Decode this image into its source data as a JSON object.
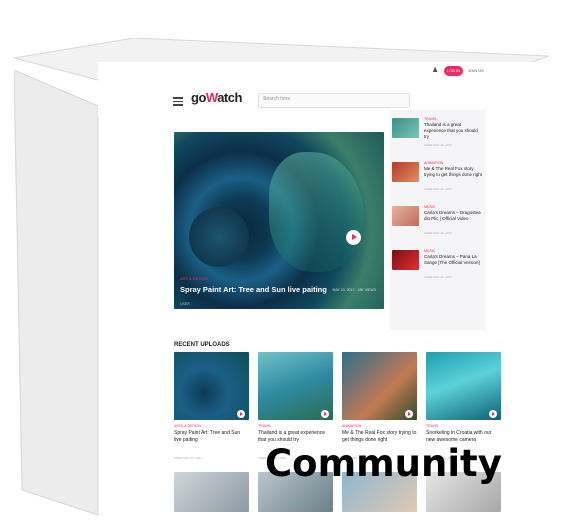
{
  "header": {
    "logo_text_pre": "go",
    "logo_text_accent": "W",
    "logo_text_post": "atch",
    "search_placeholder": "Search here",
    "signin_label": "LOG IN",
    "join_label": "JOIN US"
  },
  "hero": {
    "category": "ART & DESIGN",
    "title": "Spray Paint Art: Tree and Sun live paiting",
    "date": "MAY 24, 2017",
    "views": "18K VIEWS",
    "author": "USER"
  },
  "sidebar": {
    "items": [
      {
        "category": "TRAVEL",
        "title": "Thailand is a great experience that you should try",
        "meta": "USER   MAY 24, 2017"
      },
      {
        "category": "ANIMATION",
        "title": "Me & The Real Fox story trying to get things done right",
        "meta": "USER   MAY 24, 2017"
      },
      {
        "category": "MUSIC",
        "title": "Carla's Dreams – Dragostea din Plic | Official Video",
        "meta": "USER   MAY 24, 2017"
      },
      {
        "category": "MUSIC",
        "title": "Carla's Dreams – Pana La Sange [The Official Version]",
        "meta": "USER   MAY 24, 2017"
      }
    ]
  },
  "recent": {
    "heading": "RECENT UPLOADS",
    "cards": [
      {
        "category": "ARTS & DESIGN",
        "title": "Spray Paint Art: Tree and Sun live paiting",
        "meta": "USER   MAY 24, 2017"
      },
      {
        "category": "TRAVEL",
        "title": "Thailand is a great experience that you should try",
        "meta": "USER   MAY 24, 2017"
      },
      {
        "category": "ANIMATION",
        "title": "Me & The Real Fox story trying to get things done right",
        "meta": "USER   MAY 24, 2017"
      },
      {
        "category": "TRAVEL",
        "title": "Snorkeling in Croatia with our new awesome camera",
        "meta": "USER   MAY 24, 2017"
      }
    ]
  },
  "brand_label": "Community",
  "colors": {
    "accent": "#ee2a60",
    "sidebar_bg": "#f5f5f7"
  }
}
